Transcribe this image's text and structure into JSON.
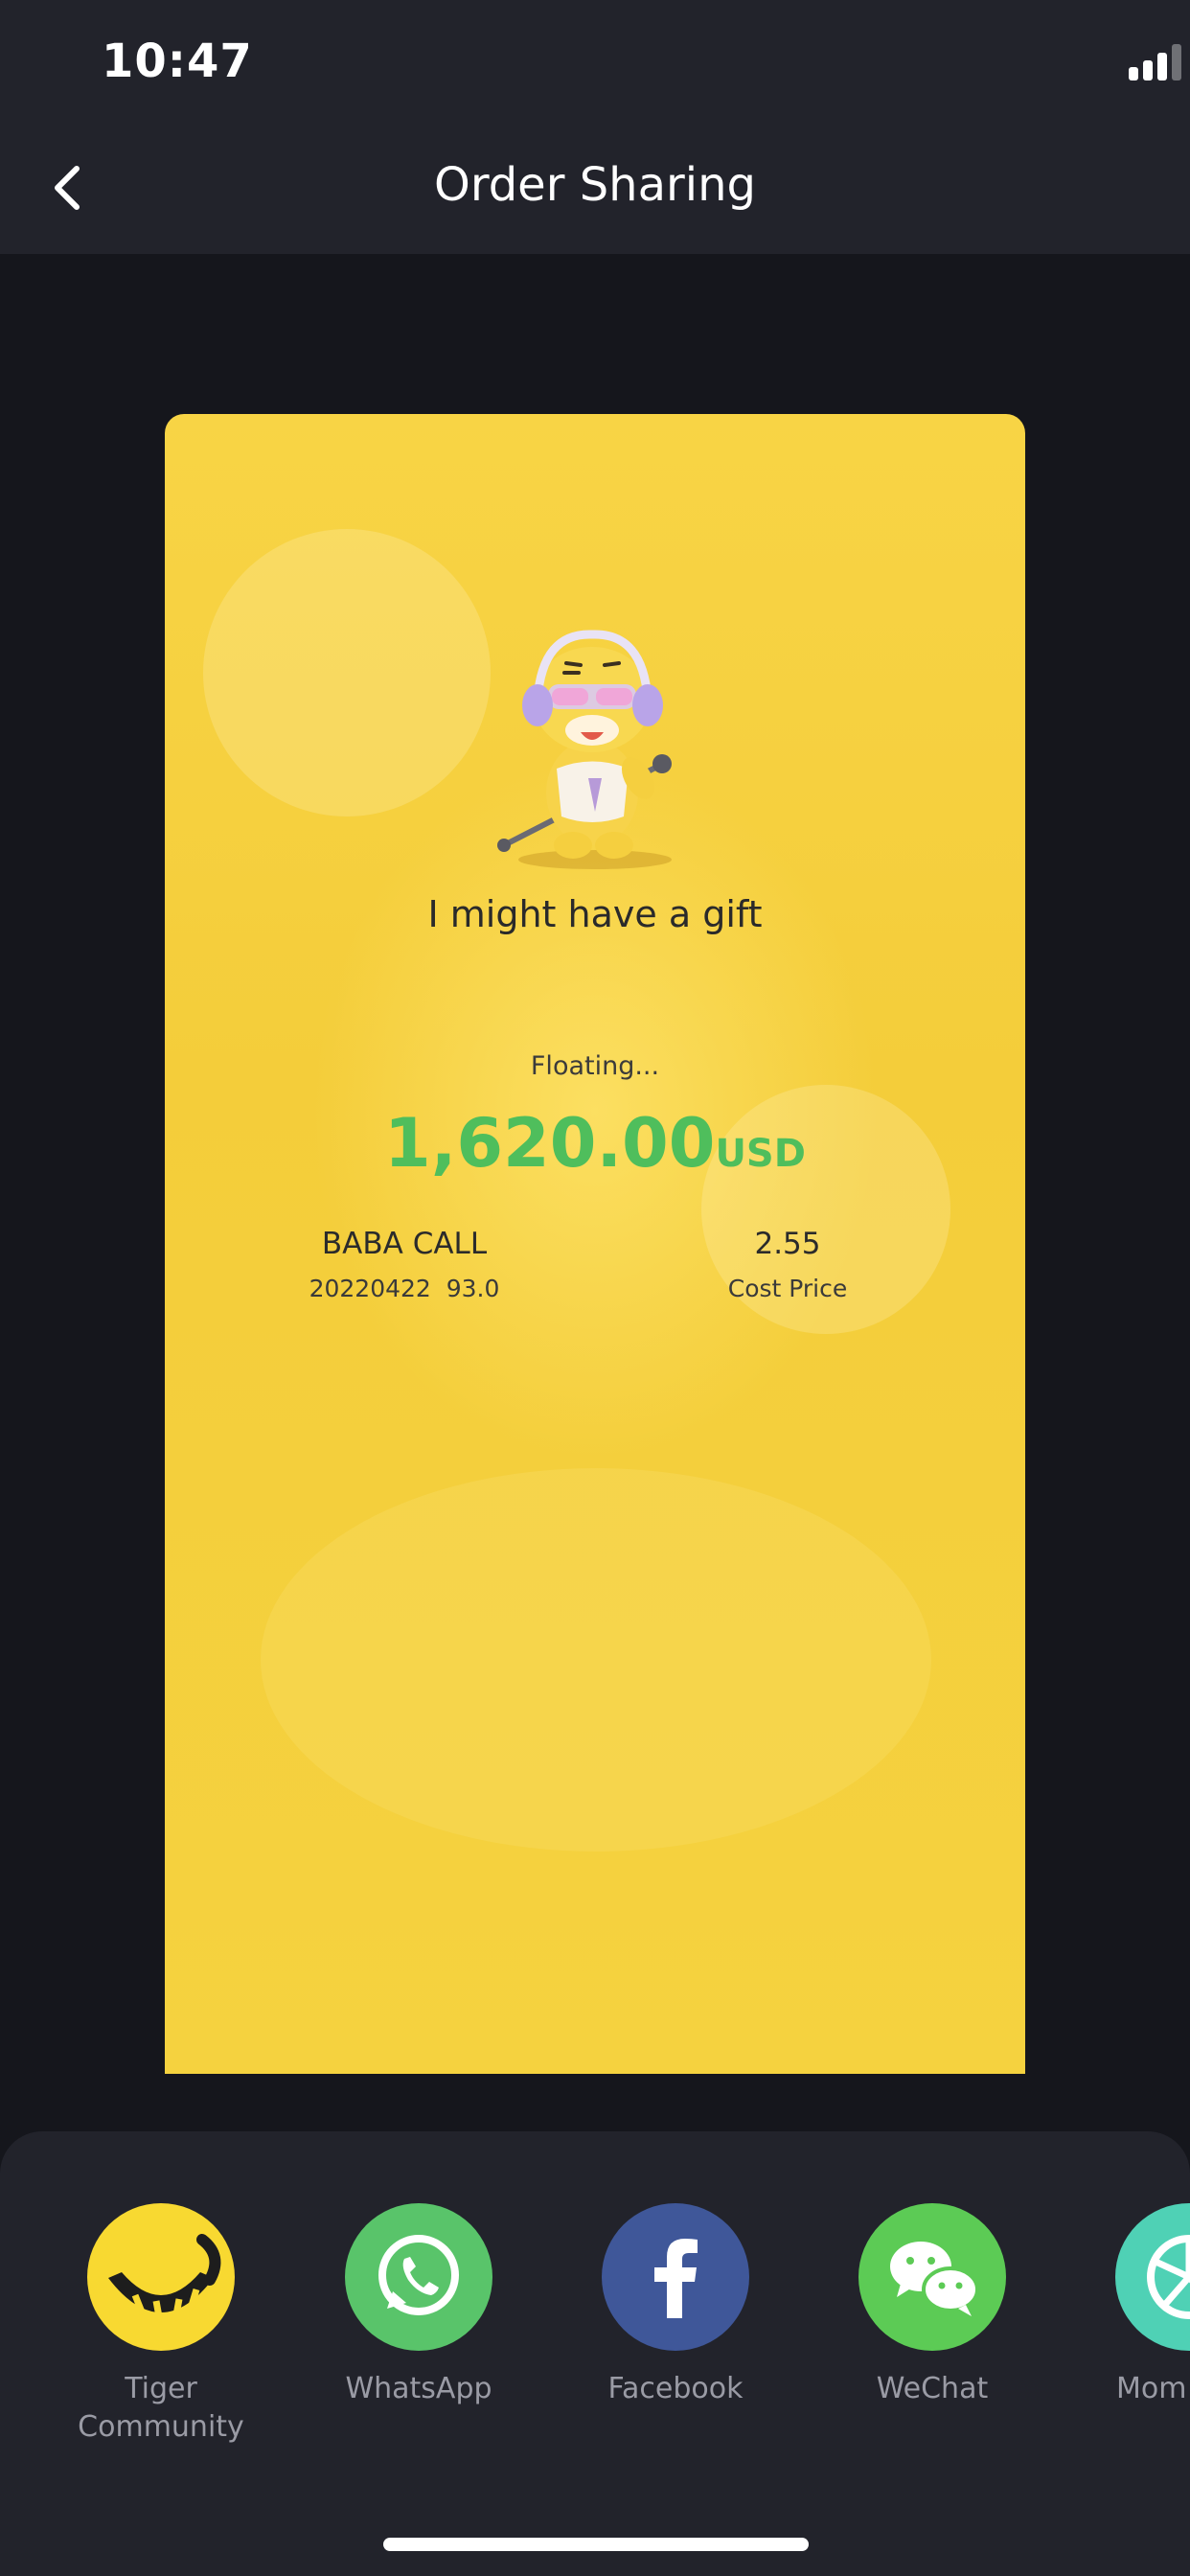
{
  "status_bar": {
    "time": "10:47"
  },
  "nav": {
    "title": "Order Sharing"
  },
  "card": {
    "tagline": "I might have a gift",
    "status": "Floating...",
    "amount": "1,620.00",
    "currency": "USD",
    "contract": "BABA CALL",
    "contract_detail": "20220422  93.0",
    "price": "2.55",
    "price_label": "Cost Price",
    "amount_color": "#4fbe5c"
  },
  "share_targets": [
    {
      "label": "Tiger\nCommunity",
      "icon": "tiger-icon",
      "color": "#f8d931"
    },
    {
      "label": "WhatsApp",
      "icon": "whatsapp-icon",
      "color": "#59c46a"
    },
    {
      "label": "Facebook",
      "icon": "facebook-icon",
      "color": "#3f5799"
    },
    {
      "label": "WeChat",
      "icon": "wechat-icon",
      "color": "#5ccb55"
    },
    {
      "label": "Mom",
      "icon": "moments-icon",
      "color": "#4fd1b5"
    }
  ]
}
